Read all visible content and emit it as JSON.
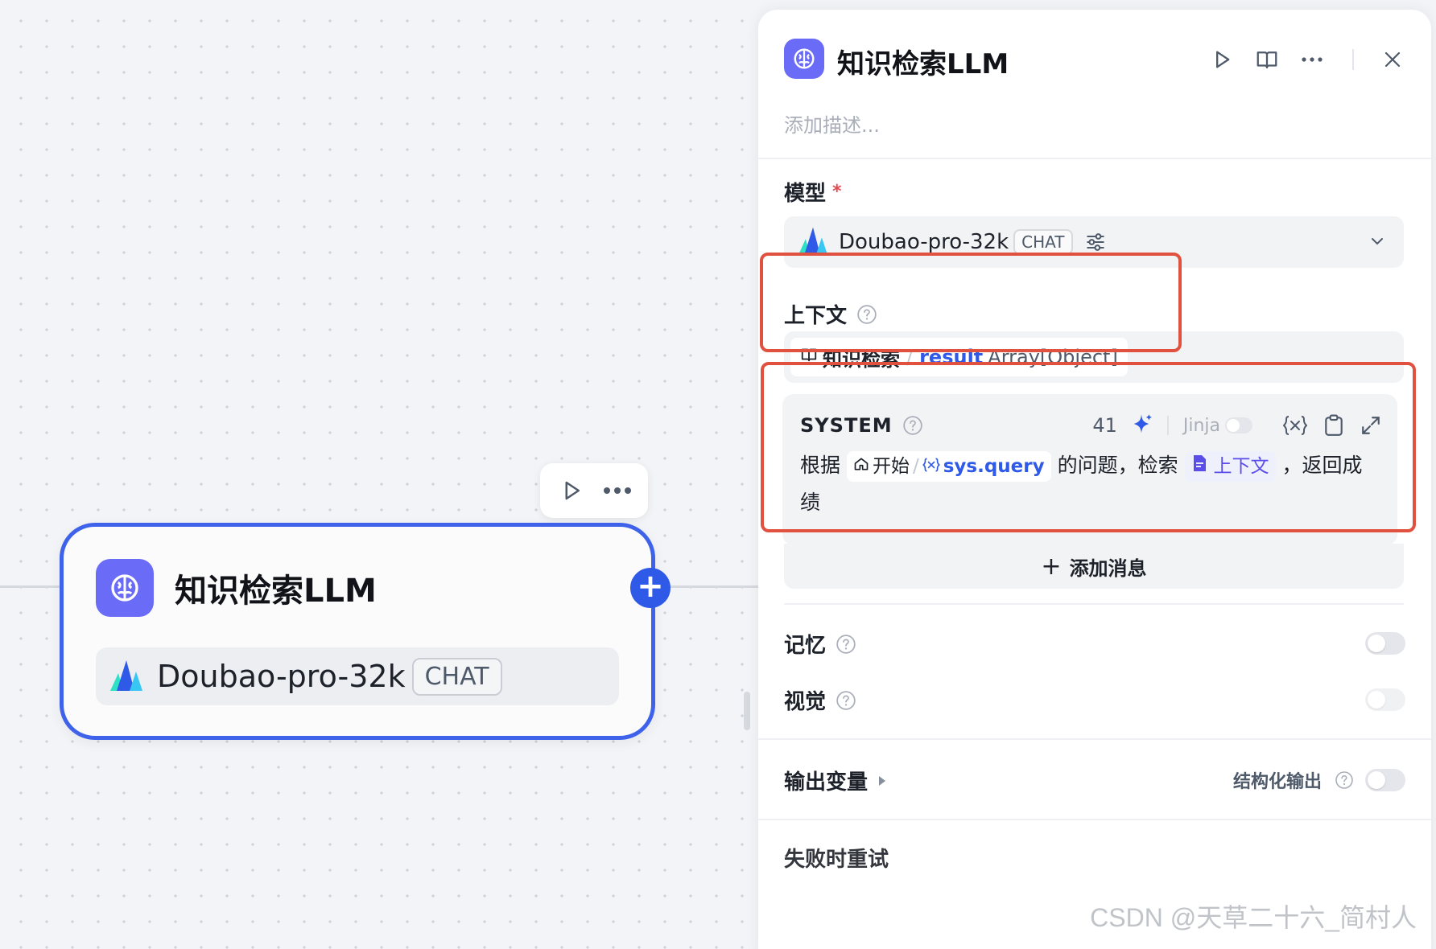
{
  "canvas": {
    "node": {
      "title": "知识检索LLM",
      "model_name": "Doubao-pro-32k",
      "model_badge": "CHAT"
    },
    "plus_label": "+"
  },
  "panel": {
    "title": "知识检索LLM",
    "description_placeholder": "添加描述...",
    "model": {
      "label": "模型",
      "required_mark": "*",
      "name": "Doubao-pro-32k",
      "badge": "CHAT"
    },
    "context": {
      "label": "上下文",
      "node_name": "知识检索",
      "separator": "/",
      "var_name": "result",
      "var_type": "Array[Object]"
    },
    "system": {
      "title": "SYSTEM",
      "token_count": "41",
      "jinja_label": "Jinja",
      "text_1": "根据",
      "chip1_node": "开始",
      "chip1_sep": "/",
      "chip1_var": "sys.query",
      "text_2": "的问题，检索",
      "chip2_label": "上下文",
      "text_3": "，返回成绩"
    },
    "add_message": "添加消息",
    "memory_label": "记忆",
    "vision_label": "视觉",
    "output_label": "输出变量",
    "structured_output_label": "结构化输出",
    "cut_label": "失败时重试"
  },
  "watermark": "CSDN @天草二十六_简村人",
  "colors": {
    "accent": "#2f5ae8",
    "node_icon": "#6a6cf7",
    "highlight_box": "#e0513f"
  }
}
